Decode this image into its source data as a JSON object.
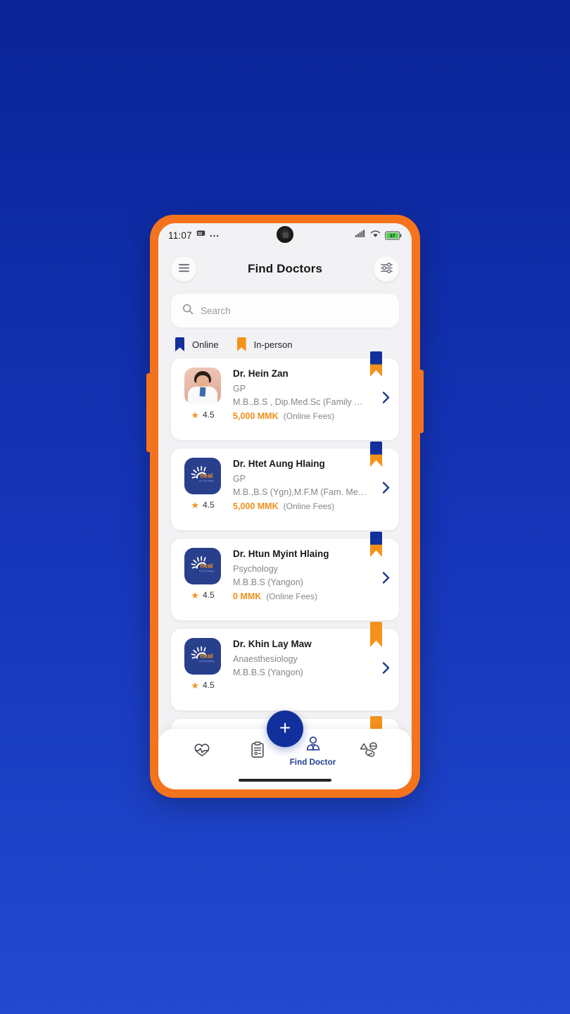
{
  "status_bar": {
    "time": "11:07",
    "message_icon": "message-icon",
    "more_icon": "more-dots-icon",
    "signal_icon": "cellular-signal-icon",
    "wifi_icon": "wifi-icon",
    "battery_level": "37"
  },
  "header": {
    "menu_icon": "hamburger-menu-icon",
    "title": "Find Doctors",
    "filter_icon": "filter-sliders-icon"
  },
  "search": {
    "icon": "search-icon",
    "placeholder": "Search",
    "value": ""
  },
  "legend": {
    "items": [
      {
        "label": "Online",
        "color": "#11309c",
        "icon": "bookmark-icon"
      },
      {
        "label": "In-person",
        "color": "#f4921c",
        "icon": "bookmark-icon"
      }
    ]
  },
  "doctors": [
    {
      "name": "Dr. Hein Zan",
      "specialty": "GP",
      "degree": "M.B.,B.S , Dip.Med.Sc (Family Medi...",
      "rating": "4.5",
      "fee_amount": "5,000 MMK",
      "fee_label": "(Online Fees)",
      "avatar_type": "photo",
      "ribbon": "dual",
      "chevron_icon": "chevron-right-icon",
      "star_icon": "star-icon"
    },
    {
      "name": "Dr. Htet Aung Hlaing",
      "specialty": "GP",
      "degree": "M.B.,B.S (Ygn),M.F.M (Fam. Med) (E...",
      "rating": "4.5",
      "fee_amount": "5,000 MMK",
      "fee_label": "(Online Fees)",
      "avatar_type": "logo",
      "ribbon": "dual",
      "chevron_icon": "chevron-right-icon",
      "star_icon": "star-icon"
    },
    {
      "name": "Dr. Htun Myint Hlaing",
      "specialty": "Psychology",
      "degree": "M.B.B.S (Yangon)",
      "rating": "4.5",
      "fee_amount": "0 MMK",
      "fee_label": "(Online Fees)",
      "avatar_type": "logo",
      "ribbon": "dual",
      "chevron_icon": "chevron-right-icon",
      "star_icon": "star-icon"
    },
    {
      "name": "Dr. Khin Lay Maw",
      "specialty": "Anaesthesiology",
      "degree": "M.B.B.S (Yangon)",
      "rating": "4.5",
      "fee_amount": "",
      "fee_label": "",
      "avatar_type": "logo",
      "ribbon": "orange",
      "chevron_icon": "chevron-right-icon",
      "star_icon": "star-icon"
    }
  ],
  "bottom_nav": {
    "fab_label": "+",
    "fab_icon": "plus-icon",
    "items": [
      {
        "label": "",
        "icon": "heart-pulse-icon",
        "active": false
      },
      {
        "label": "",
        "icon": "clipboard-record-icon",
        "active": false
      },
      {
        "label": "Find Doctor",
        "icon": "doctor-icon",
        "active": true
      },
      {
        "label": "",
        "icon": "pills-icon",
        "active": false
      }
    ]
  },
  "theme": {
    "brand_blue": "#11309c",
    "brand_orange": "#f4731c",
    "accent_orange": "#f4921c",
    "background_gradient_top": "#0a2396",
    "background_gradient_bottom": "#2249cf"
  }
}
